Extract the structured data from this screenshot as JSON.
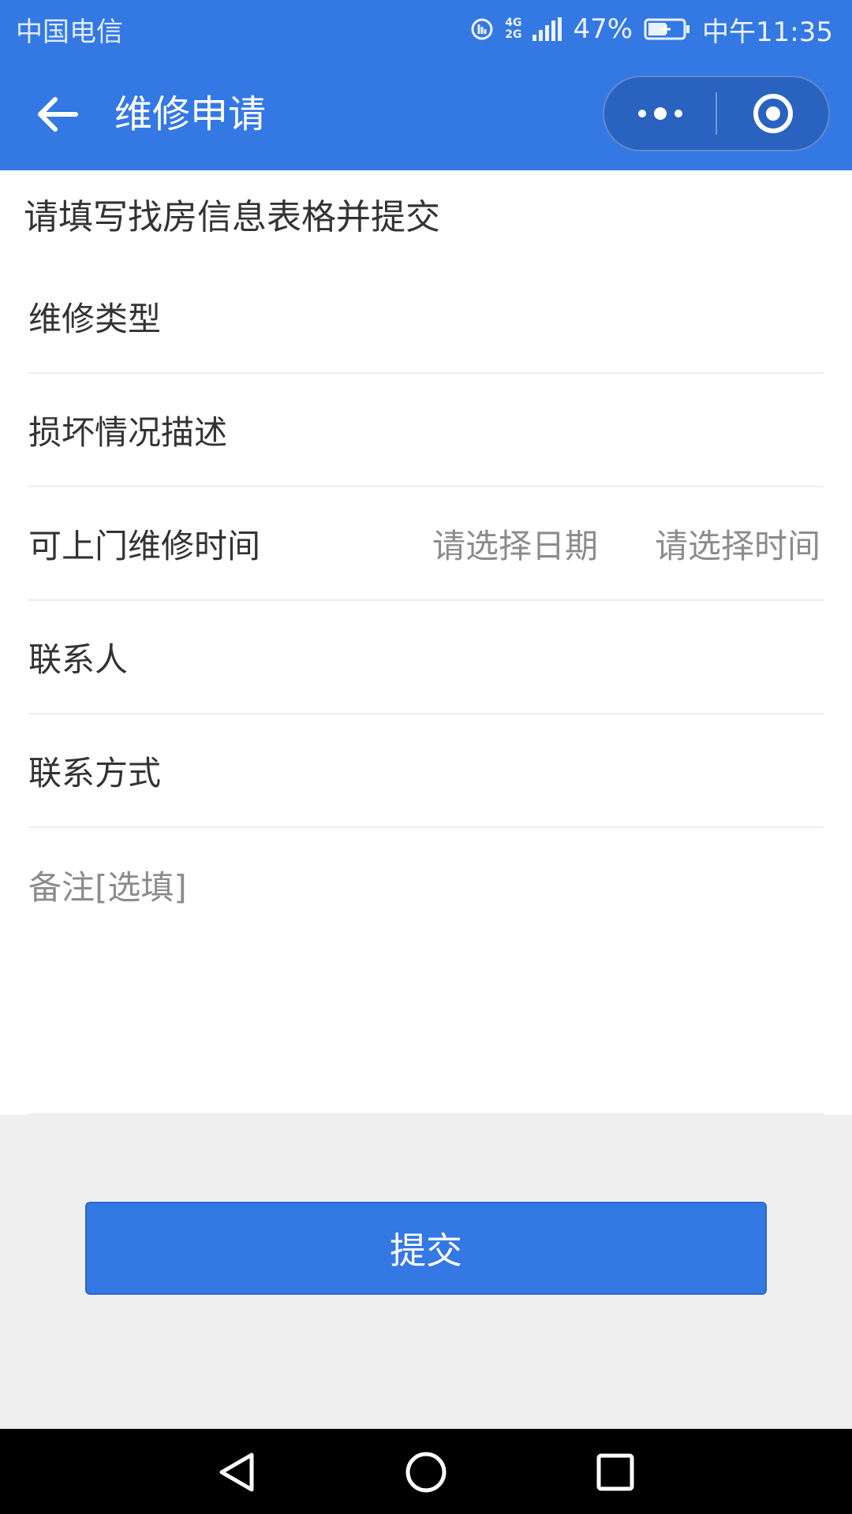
{
  "status_bar": {
    "carrier": "中国电信",
    "network_top": "4G",
    "network_bottom": "2G",
    "battery": "47%",
    "time": "中午11:35"
  },
  "nav": {
    "title": "维修申请",
    "back_icon": "arrow-left-icon",
    "more_icon": "more-dots-icon",
    "close_icon": "target-circle-icon"
  },
  "form": {
    "heading": "请填写找房信息表格并提交",
    "rows": [
      {
        "label": "维修类型"
      },
      {
        "label": "损坏情况描述"
      },
      {
        "label": "可上门维修时间",
        "date_placeholder": "请选择日期",
        "time_placeholder": "请选择时间"
      },
      {
        "label": "联系人"
      },
      {
        "label": "联系方式"
      }
    ],
    "remark_placeholder": "备注[选填]"
  },
  "submit": {
    "label": "提交"
  },
  "colors": {
    "primary": "#3478e3",
    "capsule": "#2a62bf",
    "page_bg": "#efefef",
    "text": "#333333",
    "placeholder": "#8c8c8c"
  }
}
